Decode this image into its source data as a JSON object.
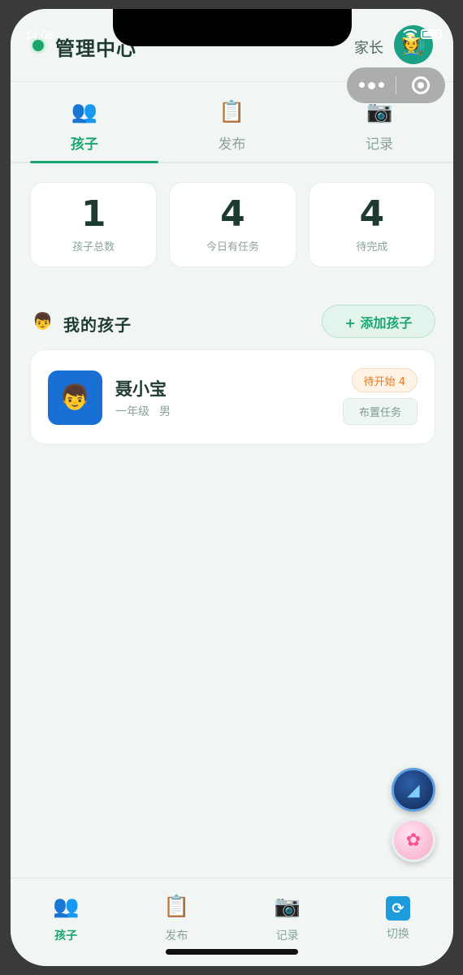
{
  "status": {
    "time": "14:05"
  },
  "header": {
    "title": "管理中心",
    "role": "家长",
    "avatar_icon": "🧑‍🌾"
  },
  "top_tabs": [
    {
      "label": "孩子",
      "icon": "👥",
      "active": true
    },
    {
      "label": "发布",
      "icon": "📋",
      "active": false
    },
    {
      "label": "记录",
      "icon": "📷",
      "active": false
    }
  ],
  "stats": [
    {
      "value": "1",
      "label": "孩子总数"
    },
    {
      "value": "4",
      "label": "今日有任务"
    },
    {
      "value": "4",
      "label": "待完成"
    }
  ],
  "section": {
    "emoji": "👦",
    "title": "我的孩子",
    "add_label": "+ 添加孩子"
  },
  "child": {
    "avatar_icon": "👦",
    "name": "聂小宝",
    "grade": "一年级",
    "gender": "男",
    "status_badge": "待开始 4",
    "assign_label": "布置任务"
  },
  "fabs": {
    "fab1_icon": "◢",
    "fab2_icon": "✿"
  },
  "bottom_nav": [
    {
      "label": "孩子",
      "icon": "👥",
      "active": true
    },
    {
      "label": "发布",
      "icon": "📋",
      "active": false
    },
    {
      "label": "记录",
      "icon": "📷",
      "active": false
    },
    {
      "label": "切换",
      "icon": "⟳",
      "active": false
    }
  ],
  "colors": {
    "accent": "#1aa66e",
    "text_dark": "#1e3b30",
    "muted": "#8aa39a",
    "background": "#f1f6f4"
  }
}
